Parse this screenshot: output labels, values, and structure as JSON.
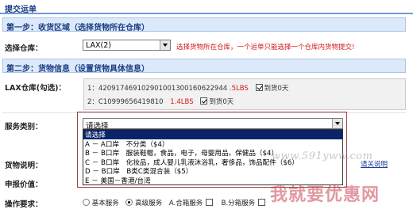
{
  "page": {
    "title": "提交运单"
  },
  "step1": {
    "header": "第一步：收货区域（选择货物所在仓库）",
    "warehouse_label": "选择仓库：",
    "warehouse_value": "LAX(2)",
    "warehouse_hint": "选择货物所在仓库，一个运单只能选择一个仓库内货物提交!"
  },
  "step2": {
    "header": "第二步：货物信息（设置货物具体信息）",
    "lax_label": "LAX仓库(勾选)：",
    "packages": [
      {
        "prefix": "1：",
        "tracking": "420917469102901001300160622944",
        "weight": ".5LBS",
        "checked": true,
        "stock": "到货0天"
      },
      {
        "prefix": "2：",
        "tracking": "C10999656419810",
        "weight": "1.4LBS",
        "checked": true,
        "stock": "到货0天"
      }
    ],
    "service_label": "服务类别：",
    "service_value": "请选择",
    "service_options": [
      {
        "label": "请选择",
        "selected": true
      },
      {
        "label": "A － A口岸　不分类（$4）",
        "selected": false
      },
      {
        "label": "B － B口岸　服装鞋帽，食品，电子，母婴用品，保健品（$4）",
        "selected": false
      },
      {
        "label": "C － B口岸　化妆品，成人婴儿乳液沐浴乳，奢侈品，饰品配件（$6）",
        "selected": false
      },
      {
        "label": "D － B口岸　B类C类混合装（$5）",
        "selected": false
      },
      {
        "label": "E － 美国－香港/台湾",
        "selected": false
      }
    ],
    "goods_desc_label": "货物说明：",
    "goods_desc_link": "请关说明",
    "declared_value_label": "申报价值：",
    "ops_label": "操作要求：",
    "ops_options": [
      {
        "label": "基本服务",
        "type": "radio",
        "checked": false
      },
      {
        "label": "高级服务",
        "type": "radio",
        "checked": true
      },
      {
        "label": "A.合箱服务",
        "type": "checkbox",
        "checked": false
      },
      {
        "label": "B.分箱服务",
        "type": "checkbox",
        "checked": false
      }
    ]
  },
  "watermark": {
    "url": "www.591yww.com",
    "text": "我就要优惠网"
  }
}
